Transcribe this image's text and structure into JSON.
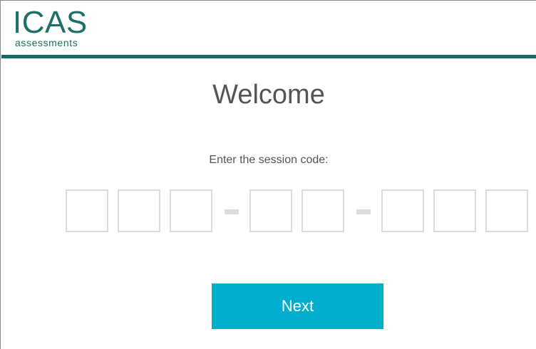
{
  "header": {
    "logo_main": "ICAS",
    "logo_sub": "assessments",
    "accent_color": "#0f6b63"
  },
  "main": {
    "title": "Welcome",
    "prompt": "Enter the session code:",
    "code_groups": [
      [
        "",
        "",
        ""
      ],
      [
        "",
        ""
      ],
      [
        "",
        "",
        ""
      ]
    ],
    "next_label": "Next",
    "button_color": "#00aecd"
  }
}
